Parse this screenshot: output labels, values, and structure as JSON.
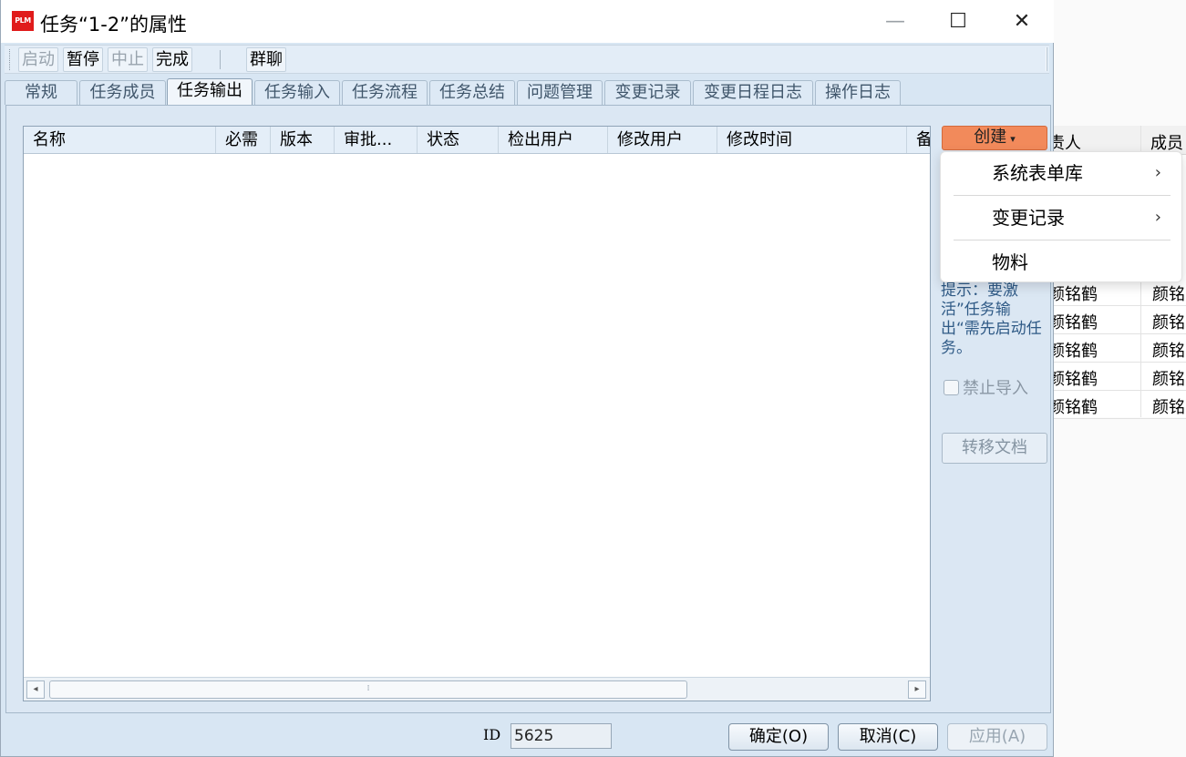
{
  "window": {
    "logo_text": "PLM",
    "title": "任务“1-2”的属性",
    "minimize": "—",
    "maximize": "☐",
    "close": "✕"
  },
  "toolbar": {
    "start": "启动",
    "pause": "暂停",
    "stop": "中止",
    "finish": "完成",
    "group_chat": "群聊"
  },
  "tabs": [
    {
      "label": "常规"
    },
    {
      "label": "任务成员"
    },
    {
      "label": "任务输出"
    },
    {
      "label": "任务输入"
    },
    {
      "label": "任务流程"
    },
    {
      "label": "任务总结"
    },
    {
      "label": "问题管理"
    },
    {
      "label": "变更记录"
    },
    {
      "label": "变更日程日志"
    },
    {
      "label": "操作日志"
    }
  ],
  "active_tab": "任务输出",
  "grid": {
    "columns": [
      "名称",
      "必需",
      "版本",
      "审批...",
      "状态",
      "检出用户",
      "修改用户",
      "修改时间",
      "备"
    ],
    "rows": [],
    "scroll_thumb_label": "⁞"
  },
  "create_button": {
    "label": "创建",
    "caret": "▾"
  },
  "create_menu": {
    "items": [
      {
        "label": "系统表单库",
        "has_submenu": true
      },
      {
        "label": "变更记录",
        "has_submenu": true
      },
      {
        "label": "物料",
        "has_submenu": false
      }
    ]
  },
  "hint_text": "提示：要激活”任务输出“需先启动任务。",
  "forbid_import": {
    "label": "禁止导入",
    "checked": false
  },
  "transfer_button": "转移文档",
  "footer": {
    "id_label": "ID",
    "id_value": "5625",
    "ok": "确定(O)",
    "cancel": "取消(C)",
    "apply": "应用(A)"
  },
  "background_table": {
    "headers": [
      "责人",
      "成员"
    ],
    "rows": [
      [
        "颜铭鹤",
        "颜铭"
      ],
      [
        "颜铭鹤",
        "颜铭"
      ],
      [
        "颜铭鹤",
        "颜铭"
      ],
      [
        "颜铭鹤",
        "颜铭"
      ],
      [
        "颜铭鹤",
        "颜铭"
      ]
    ]
  }
}
